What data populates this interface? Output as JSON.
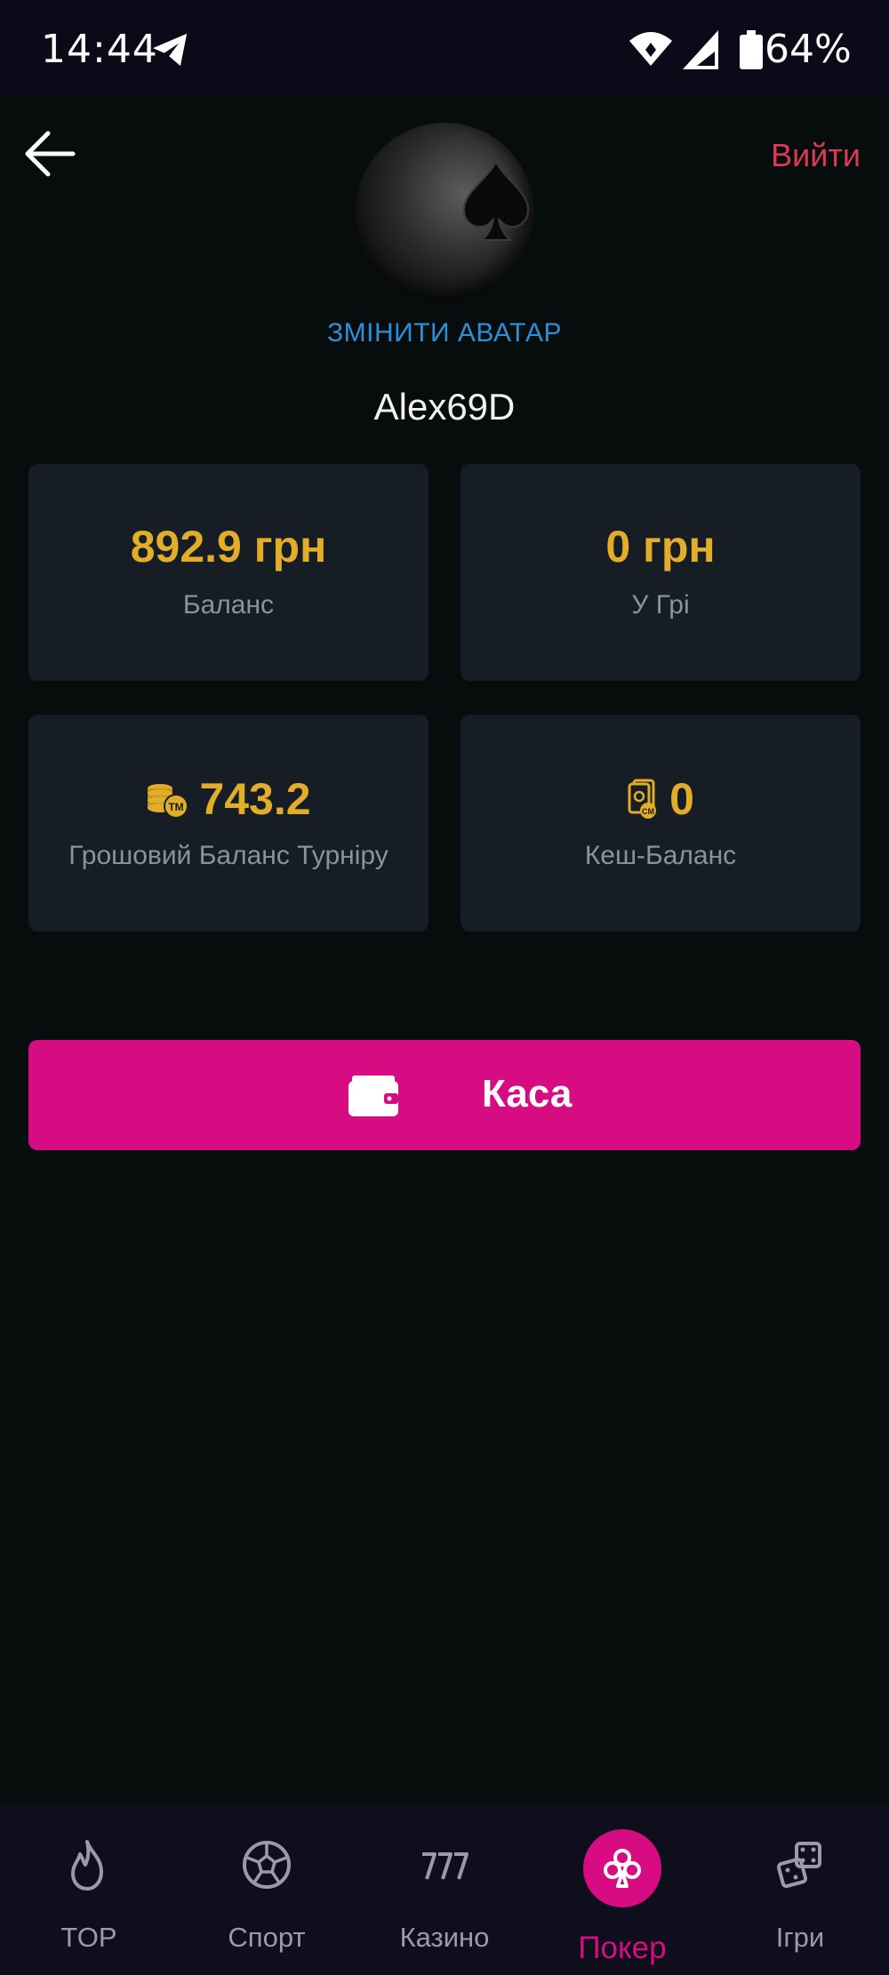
{
  "status_bar": {
    "time": "14:44",
    "battery": "64%",
    "icons": [
      "telegram-icon",
      "wifi-icon",
      "signal-icon",
      "battery-icon"
    ]
  },
  "header": {
    "back_icon": "arrow-left-icon",
    "logout_label": "Вийти",
    "avatar_icon": "spade-icon",
    "change_avatar_label": "ЗМІНИТИ АВАТАР",
    "username": "Alex69D"
  },
  "balances": {
    "balance": {
      "value": "892.9 грн",
      "label": "Баланс"
    },
    "in_game": {
      "value": "0 грн",
      "label": "У Грі"
    },
    "tournament": {
      "icon": "tournament-money-coins-icon",
      "value": "743.2",
      "label": "Грошовий Баланс Турніру"
    },
    "cash": {
      "icon": "cash-balance-cards-icon",
      "value": "0",
      "label": "Кеш-Баланс"
    }
  },
  "cashier": {
    "icon": "wallet-icon",
    "label": "Каса"
  },
  "bottom_nav": {
    "items": [
      {
        "label": "TOP",
        "icon": "flame-icon",
        "active": false
      },
      {
        "label": "Спорт",
        "icon": "soccer-ball-icon",
        "active": false
      },
      {
        "label": "Казино",
        "icon": "slots-777-icon",
        "active": false
      },
      {
        "label": "Покер",
        "icon": "club-icon",
        "active": true
      },
      {
        "label": "Ігри",
        "icon": "dice-icon",
        "active": false
      }
    ]
  },
  "colors": {
    "background": "#060d0c",
    "card": "#161d24",
    "accent_pink": "#d80c82",
    "gold": "#e2ad28",
    "logout_red": "#dc3a52",
    "link_blue": "#2f8fd6",
    "nav_bg": "#0f0e1c"
  }
}
